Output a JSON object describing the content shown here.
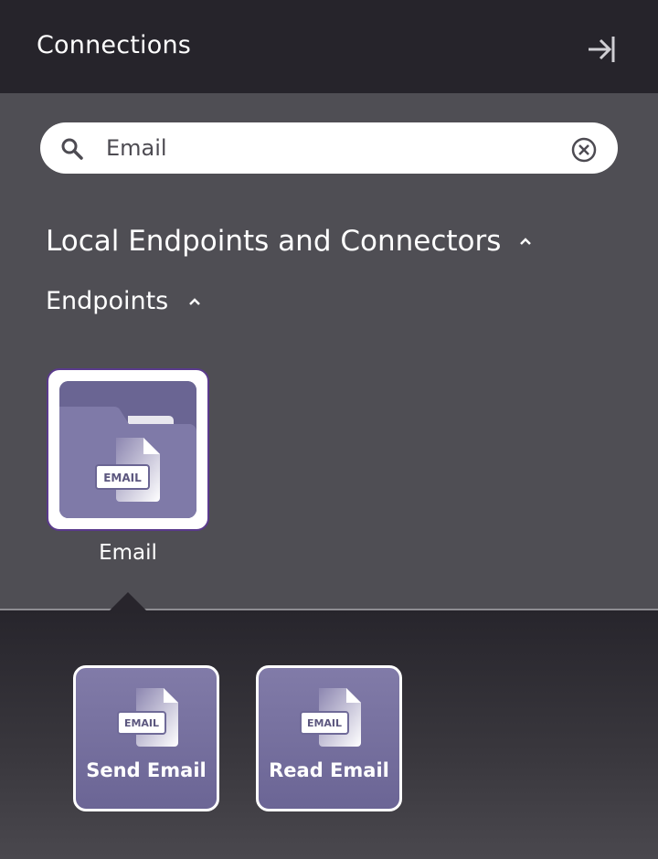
{
  "header": {
    "title": "Connections",
    "collapse_icon": "arrow-right-to-bar-icon"
  },
  "search": {
    "value": "Email",
    "search_icon": "magnifier-icon",
    "clear_icon": "circle-x-icon"
  },
  "sections": {
    "main_title": "Local Endpoints and Connectors",
    "main_expanded": true,
    "sub_title": "Endpoints",
    "sub_expanded": true
  },
  "endpoints": [
    {
      "label": "Email",
      "badge": "EMAIL",
      "selected": true
    }
  ],
  "activities": [
    {
      "label": "Send Email",
      "badge": "EMAIL"
    },
    {
      "label": "Read Email",
      "badge": "EMAIL"
    }
  ],
  "colors": {
    "header_bg": "#26242b",
    "panel_bg": "#4f4e54",
    "tile_purple": "#6a6593",
    "selected_border": "#5a3a8c"
  }
}
